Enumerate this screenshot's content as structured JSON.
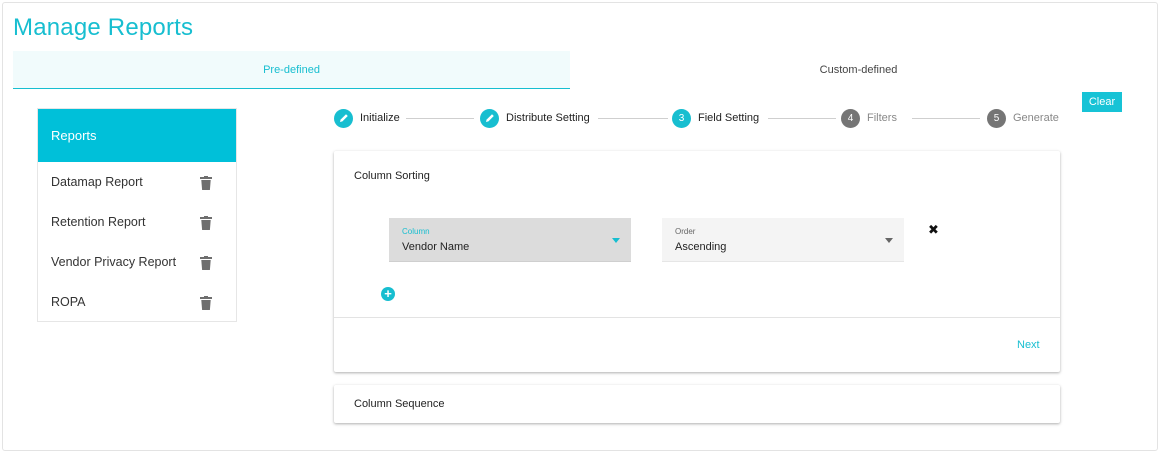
{
  "page": {
    "title": "Manage Reports"
  },
  "tabs": [
    {
      "label": "Pre-defined",
      "active": true
    },
    {
      "label": "Custom-defined",
      "active": false
    }
  ],
  "clear_button": {
    "label": "Clear"
  },
  "sidebar": {
    "header": "Reports",
    "items": [
      {
        "label": "Datamap Report",
        "icon": "trash-icon"
      },
      {
        "label": "Retention Report",
        "icon": "trash-icon"
      },
      {
        "label": "Vendor Privacy Report",
        "icon": "trash-icon"
      },
      {
        "label": "ROPA",
        "icon": "trash-icon"
      }
    ]
  },
  "stepper": {
    "steps": [
      {
        "label": "Initialize",
        "marker": "pencil-icon",
        "state": "completed"
      },
      {
        "label": "Distribute Setting",
        "marker": "pencil-icon",
        "state": "completed"
      },
      {
        "label": "Field Setting",
        "marker": "3",
        "state": "active"
      },
      {
        "label": "Filters",
        "marker": "4",
        "state": "inactive"
      },
      {
        "label": "Generate",
        "marker": "5",
        "state": "inactive"
      }
    ]
  },
  "column_sorting": {
    "title": "Column Sorting",
    "column_field": {
      "label": "Column",
      "value": "Vendor Name"
    },
    "order_field": {
      "label": "Order",
      "value": "Ascending"
    },
    "next_label": "Next"
  },
  "column_sequence": {
    "title": "Column Sequence"
  },
  "colors": {
    "accent": "#17bed0",
    "sidebar_header": "#00c0d9",
    "inactive_step": "#757575"
  }
}
